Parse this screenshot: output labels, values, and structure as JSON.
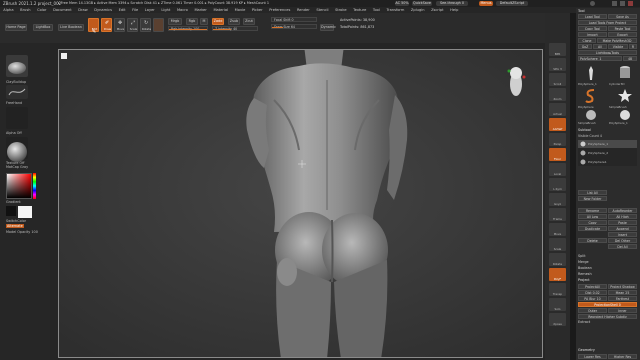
{
  "titlebar": {
    "app_info": "ZBrush 2021.1.2 project_002",
    "stats": "▸ Free Mem 14.13GB ▸ Active Mem 3394 ▸ Scratch Disk 41 ▸ ZTime 0.061 Timer 0.001 ▸ PolyCount 38.919 KP ▸ MeshCount 1",
    "ac_label": "AC 50%",
    "quicksave_label": "QuickSave",
    "seethrough_label": "See-through 0",
    "menus_label": "Menus",
    "script_label": "DefaultZScript"
  },
  "menubar": {
    "items": [
      "Alpha",
      "Brush",
      "Color",
      "Document",
      "Draw",
      "Dynamics",
      "Edit",
      "File",
      "Layer",
      "Light",
      "Macro",
      "Marker",
      "Material",
      "Movie",
      "Picker",
      "Preferences",
      "Render",
      "Stencil",
      "Stroke",
      "Texture",
      "Tool",
      "Transform",
      "Zplugin",
      "Zscript",
      "Help"
    ]
  },
  "toolbar": {
    "home_page": "Home Page",
    "lightbox": "LightBox",
    "live_boolean": "Live Boolean",
    "edit": "Edit",
    "draw": "Draw",
    "move": "Move",
    "scale": "Scale",
    "rotate": "Rotate",
    "mrgb": "Mrgb",
    "rgb": "Rgb",
    "m": "M",
    "zadd": "Zadd",
    "zsub": "Zsub",
    "zcut": "Zcut",
    "rgb_intensity": "Rgb Intensity 100",
    "z_intensity": "Z Intensity 40",
    "focal_shift": "Focal Shift 0",
    "draw_size": "Draw Size 64",
    "dynamic": "Dynamic",
    "active_points": "ActivePoints: 38,900",
    "total_points": "TotalPoints: 861,873"
  },
  "coords": "0.402,0.471,0.524",
  "leftshelf": {
    "brush_label": "ClayBuildup",
    "stroke_label": "FreeHand",
    "alpha_label": "Alpha Off",
    "texture_label": "Texture Off",
    "material_label": "MatCap Gray",
    "gradient_label": "Gradient",
    "switch_color": "SwitchColor",
    "alternate_label": "Alternate",
    "model_opacity": "Model Opacity 100"
  },
  "palette": {
    "title": "Tool",
    "load_tool": "Load Tool",
    "save_as": "Save As",
    "load_from_project": "Load Tools From Project",
    "copy_tool": "Copy Tool",
    "paste_tool": "Paste Tool",
    "import": "Import",
    "export": "Export",
    "clone": "Clone",
    "make_polymesh": "Make PolyMesh3D",
    "goz": "GoZ",
    "all": "All",
    "visible": "Visible",
    "r": "R",
    "lightbox_tools": "Lightbox▸Tools",
    "current_tool": "PolySphere_1",
    "current_tool_count": "48",
    "thumb_labels": [
      "PolySphere_1",
      "Cylinder3D",
      "PolySphere",
      "SimpleBrush",
      "SimpleBrush",
      "PolySphere_1"
    ],
    "subtool_header": "Subtool",
    "visible_count": "Visible Count 4",
    "subtools": [
      "PolySphere_1",
      "PolySphere_2",
      "PolySphere1"
    ],
    "list_all": "List All",
    "new_folder": "New Folder",
    "rename": "Rename",
    "autoreorder": "AutoReorder",
    "all_low": "All Low",
    "all_high": "All High",
    "copy": "Copy",
    "paste": "Paste",
    "duplicate": "Duplicate",
    "append": "Append",
    "insert": "Insert",
    "del_other": "Del Other",
    "delete": "Delete",
    "del_all": "Del All",
    "split": "Split",
    "merge": "Merge",
    "boolean": "Boolean",
    "remesh": "Remesh",
    "project_header": "Project",
    "project_all": "ProjectAll",
    "project_shadow": "Project Shadow",
    "dist": "Dist 0.02",
    "mean": "Mean 25",
    "pa_blur": "PA Blur 10",
    "farthest": "Farthest",
    "projection_shell": "ProjectionShell 0",
    "outer": "Outer",
    "inner": "Inner",
    "reproject_higher": "Reproject Higher Subdiv",
    "extract": "Extract",
    "geometry_header": "Geometry",
    "lower_res": "Lower Res",
    "higher_res": "Higher Res",
    "sel_label": "Sel",
    "color_label": "Color"
  },
  "rightcol": {
    "buttons": [
      "BPR",
      "SPix 3",
      "Scroll",
      "Zoom",
      "Actual",
      "AAHalf",
      "Persp",
      "Floor",
      "Local",
      "L.Sym",
      "Gxyz",
      "Frame",
      "Move",
      "Scale",
      "Rotate",
      "PolyF",
      "Transp",
      "Solo",
      "Xpose"
    ]
  },
  "colors": {
    "accent": "#d8742a",
    "accent_dark": "#c15a1c",
    "bg": "#2b2b2b",
    "canvas": "#3a3a3a"
  }
}
